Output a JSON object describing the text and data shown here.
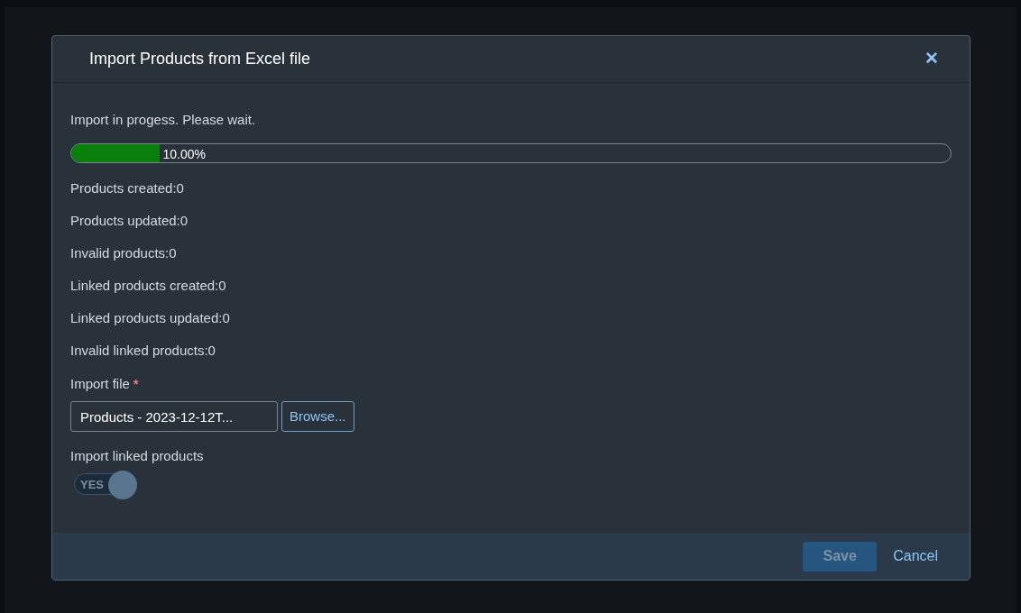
{
  "dialog": {
    "title": "Import Products from Excel file",
    "close": "✕"
  },
  "progress": {
    "message": "Import in progess. Please wait.",
    "level": 0.1,
    "reading": "10.00%"
  },
  "stats": [
    "Products created:0",
    "Products updated:0",
    "Invalid products:0",
    "Linked products created:0",
    "Linked products updated:0",
    "Invalid linked products:0"
  ],
  "import_file": {
    "label": "Import file",
    "required": true,
    "required_mark": "*",
    "value": "Products - 2023-12-12T...",
    "browse": "Browse..."
  },
  "linked": {
    "label": "Import linked products",
    "toggle_text": "YES",
    "on": true
  },
  "buttons": [
    {
      "label": "Save",
      "kind": "primary",
      "disabled": true
    },
    {
      "label": "Cancel",
      "kind": "link",
      "disabled": false
    }
  ]
}
